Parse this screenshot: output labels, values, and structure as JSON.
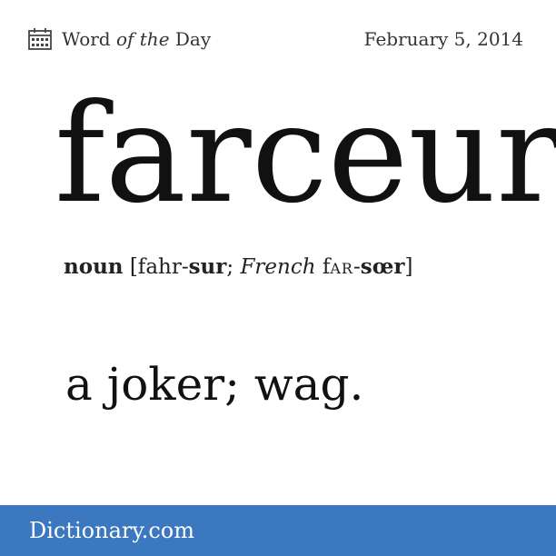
{
  "header": {
    "icon": "calendar-icon",
    "title_word": "Word ",
    "title_of_the": "of the",
    "title_day": " Day",
    "date": "February 5, 2014"
  },
  "entry": {
    "word": "farceur",
    "part_of_speech": "noun",
    "pron_open": " [fahr-",
    "pron_stress": "sur",
    "pron_sep": "; ",
    "pron_lang": "French",
    "pron_french_1": " f",
    "pron_french_sc": "AR",
    "pron_dash": "-",
    "pron_french_stress": "sœr",
    "pron_close": "]",
    "definition": "a joker; wag."
  },
  "footer": {
    "brand": "Dictionary.com",
    "color": "#3b78bf"
  }
}
